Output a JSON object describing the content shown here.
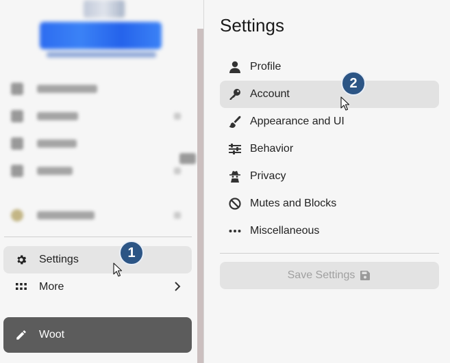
{
  "sidebar": {
    "blurred_items": [
      "Dashboard",
      "Explore",
      "Search",
      "Other",
      "profile"
    ],
    "settings_label": "Settings",
    "more_label": "More",
    "woot_label": "Woot"
  },
  "settings": {
    "title": "Settings",
    "items": [
      {
        "label": "Profile",
        "icon": "person-icon"
      },
      {
        "label": "Account",
        "icon": "key-icon"
      },
      {
        "label": "Appearance and UI",
        "icon": "brush-icon"
      },
      {
        "label": "Behavior",
        "icon": "sliders-icon"
      },
      {
        "label": "Privacy",
        "icon": "spy-icon"
      },
      {
        "label": "Mutes and Blocks",
        "icon": "ban-icon"
      },
      {
        "label": "Miscellaneous",
        "icon": "ellipsis-icon"
      }
    ],
    "active_item": "Account",
    "save_label": "Save Settings"
  },
  "annotations": {
    "step1": "1",
    "step2": "2"
  },
  "colors": {
    "badge": "#2c5585",
    "woot_button": "#5c5c5c",
    "active_bg": "#e2e2e2"
  }
}
